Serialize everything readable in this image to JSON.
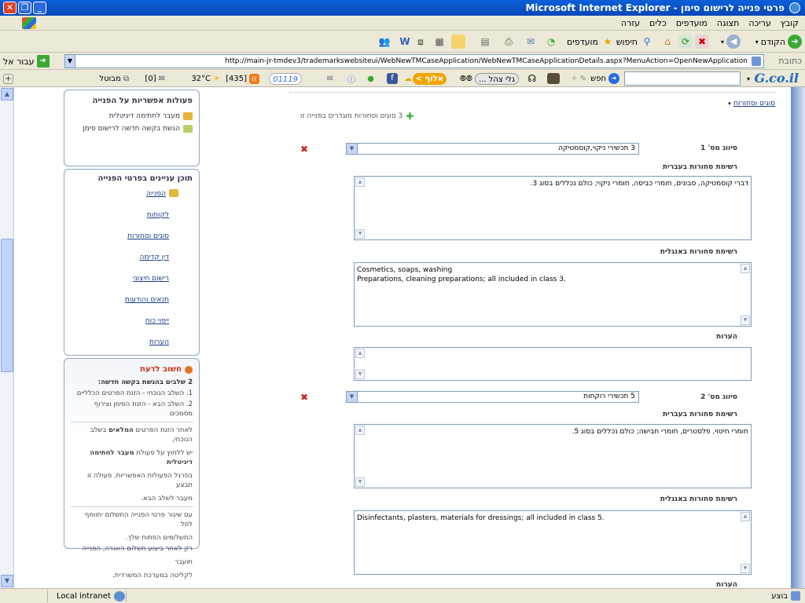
{
  "window": {
    "title": "פרטי פנייה לרישום סימן - Microsoft Internet Explorer"
  },
  "menu": [
    "קובץ",
    "עריכה",
    "תצוגה",
    "מועדפים",
    "כלים",
    "עזרה"
  ],
  "toolbar": {
    "back_label": "הקודם",
    "search_label": "חיפוש",
    "favorites_label": "מועדפים"
  },
  "address": {
    "label": "כתובת",
    "url": "http://main-jr-tmdev3/trademarkswebsiteui/WebNewTMCaseApplication/WebNewTMCaseApplicationDetails.aspx?MenuAction=OpenNewApplication",
    "go_label": "עבור אל"
  },
  "links_bar": {
    "logo": "G.co.il",
    "search_btn": "חפש",
    "galei_label": "גלי צהל ...",
    "aluf_label": "אלוף >",
    "counter": "01119",
    "rss_count": "[435]",
    "weather": "32°C",
    "mail_count": "[0]",
    "blocked_label": "מבוטל"
  },
  "actions_panel": {
    "title": "פעולות אפשריות על הפנייה",
    "items": [
      "מעבר לחתימה דיגיטלית",
      "הגשת בקשה חדשה לרישום סימן"
    ]
  },
  "nav_panel": {
    "title": "תוכן עניינים בפרטי הפנייה",
    "items": [
      "הפנייה",
      "לקוחות",
      "סוגים וסחורות",
      "דין קדימה",
      "רישום חיצוני",
      "תנאים והודעות",
      "ייפוי כוח",
      "הערות"
    ]
  },
  "info_panel": {
    "title": "חשוב לדעת",
    "subtitle": "2 שלבים בהגשת בקשה חדשה:",
    "step1": "1. השלב הנוכחי - הזנת הפרטים הכלליים",
    "step2": "2. השלב הבא - הזנת הסימן וצירוף מסמכים",
    "p1_a": "לאחר הזנת הפרטים",
    "p1_b": "המלאים",
    "p1_c": "בשלב הנוכחי,",
    "p2_a": "יש ללחוץ על פעולת",
    "p2_b": "מעבר לחתימה דיגיטלית",
    "p3": "בסרגל הפעולות האפשריות. פעולה זו תבצע",
    "p4": "מעבר לשלב הבא.",
    "p5": "עם שיגור פרטי הפנייה התשלום יתווסף לסל",
    "p6": "התשלומים הפתוח שלך.",
    "p7": "רק לאחר ביצוע תשלום האגרה, הפנייה",
    "p8": "תועבר",
    "p9": "לקליטה במערכת המשרדית."
  },
  "form": {
    "section_title": "סוגים וסחורות",
    "add_text": "3 סוגים וסחורות מוגדרים בפנייה זו",
    "classes": [
      {
        "label": "סיווג מס' 1",
        "selected": "3 תכשירי ניקוי,קוסמטיקה",
        "he_label": "רשימת סחורות בעברית",
        "he_text": "דברי קוסמטיקה, סבונים, חומרי כביסה, חומרי ניקוי; כולם נכללים בסוג 3.",
        "en_label": "רשימת סחורות באנגלית",
        "en_text_1": "Cosmetics, soaps, washing",
        "en_text_2": "Preparations, cleaning preparations; all included in class 3.",
        "notes_label": "הערות",
        "notes": ""
      },
      {
        "label": "סיווג מס' 2",
        "selected": "5 תכשירי רוקחות",
        "he_label": "רשימת סחורות בעברית",
        "he_text": "חומרי חיטוי, פלסטרים, חומרי חבישה; כולם נכללים בסוג 5.",
        "en_label": "רשימת סחורות באנגלית",
        "en_text": "Disinfectants, plasters, materials for dressings; all included in class 5.",
        "notes_label": "הערות"
      }
    ]
  },
  "status": {
    "done": "בוצע",
    "zone": "Local intranet"
  },
  "colors": {
    "titlebar": "#0a5fd8",
    "chrome": "#ece9d8",
    "link": "#1a3c8a",
    "alert": "#c83214"
  }
}
